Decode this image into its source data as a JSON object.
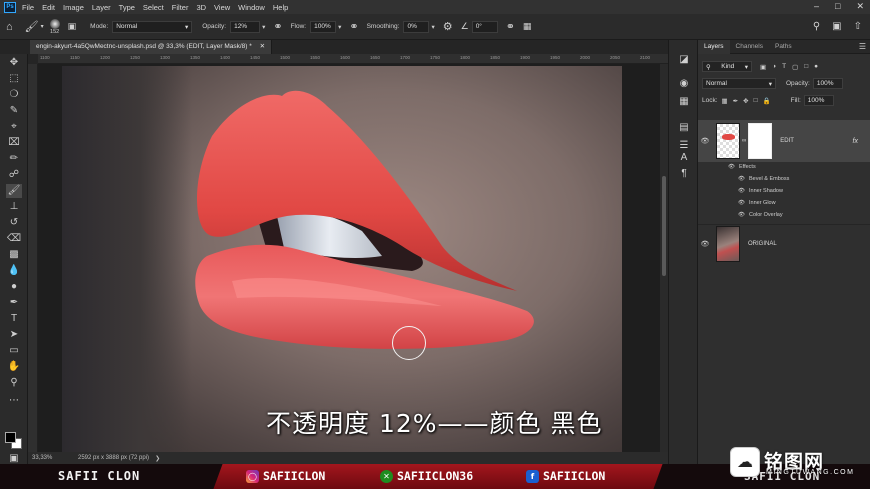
{
  "app": {
    "logo": "Ps"
  },
  "menu": [
    "File",
    "Edit",
    "Image",
    "Layer",
    "Type",
    "Select",
    "Filter",
    "3D",
    "View",
    "Window",
    "Help"
  ],
  "window_controls": [
    "–",
    "□",
    "✕"
  ],
  "options": {
    "brush_size": "152",
    "mode_label": "Mode:",
    "mode_value": "Normal",
    "opacity_label": "Opacity:",
    "opacity_value": "12%",
    "flow_label": "Flow:",
    "flow_value": "100%",
    "smoothing_label": "Smoothing:",
    "smoothing_value": "0%",
    "angle_value": "0°"
  },
  "document": {
    "tab_title": "engin-akyurt-4a5QwMectnc-unsplash.psd @ 33,3% (EDIT, Layer Mask/8) *",
    "zoom": "33,33%",
    "dimensions": "2592 px x 3888 px (72 ppi)",
    "ruler_ticks": [
      "1100",
      "1150",
      "1200",
      "1250",
      "1300",
      "1350",
      "1400",
      "1450",
      "1500",
      "1550",
      "1600",
      "1650",
      "1700",
      "1750",
      "1800",
      "1850",
      "1900",
      "1950",
      "2000",
      "2050",
      "2100"
    ]
  },
  "subtitle": "不透明度 12%——颜色 黑色",
  "layers_panel": {
    "tabs": [
      "Layers",
      "Channels",
      "Paths"
    ],
    "filter_value": "Kind",
    "blend_mode": "Normal",
    "opacity_label": "Opacity:",
    "opacity_value": "100%",
    "lock_label": "Lock:",
    "fill_label": "Fill:",
    "fill_value": "100%",
    "layers": [
      {
        "name": "EDIT",
        "fx": "fx"
      },
      {
        "name": "ORIGINAL"
      }
    ],
    "effects_label": "Effects",
    "effects": [
      "Bevel & Emboss",
      "Inner Shadow",
      "Inner Glow",
      "Color Overlay"
    ]
  },
  "banner": {
    "name": "SAFII CLON",
    "instagram": "SAFIICLON",
    "xbox": "SAFIICLON36",
    "facebook": "SAFIICLON",
    "right_name": "SAFII CLON"
  },
  "watermark": {
    "cn": "铭图网",
    "en": "MINGTUWANG.COM"
  },
  "colors": {
    "accent": "#31a8ff",
    "banner_red": "#a3161d",
    "lip_red": "#e4484a",
    "foreground": "#000000",
    "background": "#ffffff"
  },
  "icons": {
    "tools": [
      "move-icon",
      "marquee-icon",
      "lasso-icon",
      "quick-select-icon",
      "crop-icon",
      "frame-icon",
      "eyedropper-icon",
      "healing-icon",
      "brush-icon",
      "stamp-icon",
      "history-brush-icon",
      "eraser-icon",
      "gradient-icon",
      "blur-icon",
      "dodge-icon",
      "pen-icon",
      "type-icon",
      "path-select-icon",
      "rectangle-icon",
      "hand-icon",
      "zoom-icon"
    ]
  }
}
